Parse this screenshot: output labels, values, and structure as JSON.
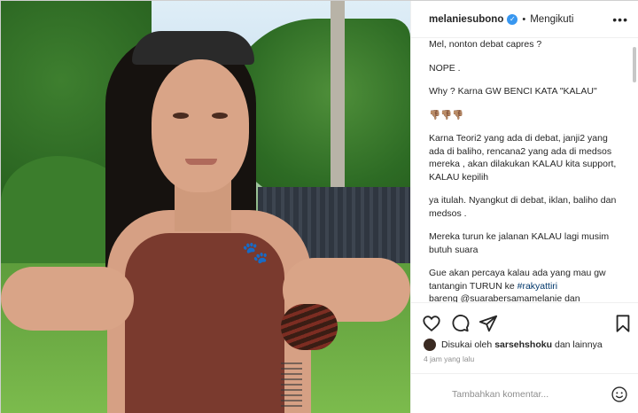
{
  "header": {
    "username": "melaniesubono",
    "verified_glyph": "✓",
    "separator": "•",
    "follow_label": "Mengikuti",
    "more_label": "•••"
  },
  "caption": {
    "lines": [
      "Mel, nonton debat capres ?",
      "NOPE .",
      "Why ? Karna GW BENCI KATA \"KALAU\"",
      "👎🏽👎🏽👎🏽",
      "Karna Teori2 yang ada di debat, janji2 yang ada di baliho, rencana2 yang ada di medsos mereka , akan dilakukan KALAU kita support, KALAU kepilih",
      "ya itulah. Nyangkut di debat, iklan, baliho dan medsos .",
      "Mereka turun ke jalanan KALAU lagi musim butuh suara",
      "Gue akan percaya kalau ada yang mau gw tantangin TURUN ke",
      "#rakyattiri",
      "bareng @suarabersamamelanie dan"
    ]
  },
  "actions": {
    "icons": [
      "heart-icon",
      "comment-icon",
      "share-icon",
      "bookmark-icon"
    ],
    "liked_by_prefix": "Disukai oleh",
    "liked_by_user": "sarsehshoku",
    "liked_by_suffix": "dan lainnya",
    "timestamp": "4 jam yang lalu"
  },
  "comment": {
    "placeholder": "Tambahkan komentar..."
  },
  "colors": {
    "accent": "#3897f0",
    "hashtag": "#00376b",
    "muted": "#8e8e8e"
  }
}
